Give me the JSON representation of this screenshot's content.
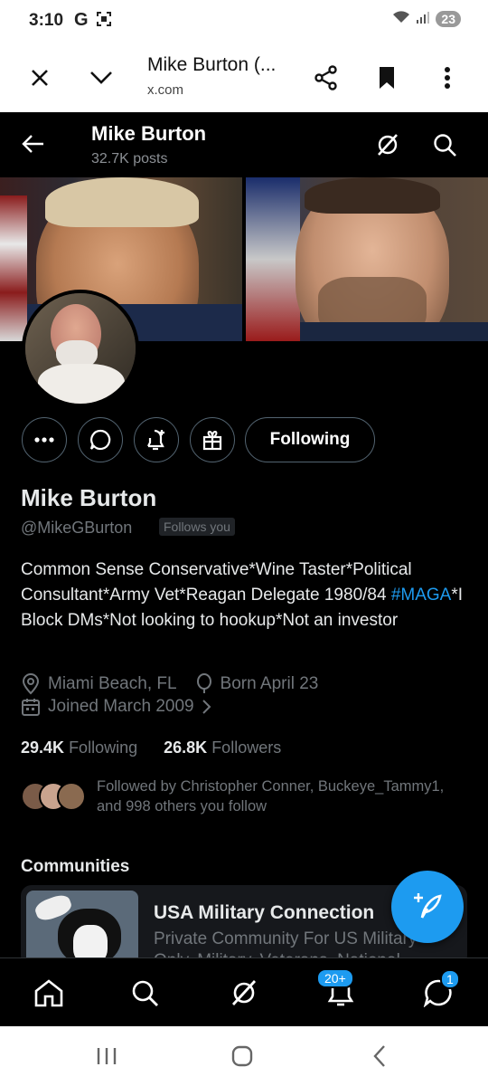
{
  "statusbar": {
    "time": "3:10",
    "g_letter": "G",
    "battery": "23"
  },
  "browser": {
    "title": "Mike Burton (...",
    "url": "x.com"
  },
  "header": {
    "name": "Mike Burton",
    "posts": "32.7K posts"
  },
  "profile": {
    "follow_button": "Following",
    "name": "Mike Burton",
    "handle": "@MikeGBurton",
    "follows_you": "Follows you",
    "bio_part1": "Common Sense Conservative*Wine Taster*Political Consultant*Army Vet*Reagan Delegate 1980/84 ",
    "bio_hashtag": "#MAGA",
    "bio_part2": "*I Block DMs*Not looking to hookup*Not an investor",
    "location": "Miami Beach, FL",
    "born": "Born April 23",
    "joined": "Joined March 2009",
    "following_count": "29.4K",
    "following_label": "Following",
    "followers_count": "26.8K",
    "followers_label": "Followers",
    "followed_by": "Followed by Christopher Conner, Buckeye_Tammy1, and 998 others you follow"
  },
  "communities": {
    "title": "Communities",
    "card_name": "USA Military Connection",
    "card_desc": "Private Community For US Military Only. Military, Veterans, National"
  },
  "nav": {
    "notifications_badge": "20+",
    "messages_badge": "1"
  },
  "colors": {
    "accent": "#1d9bf0",
    "muted": "#71767b",
    "text": "#e7e9ea"
  }
}
